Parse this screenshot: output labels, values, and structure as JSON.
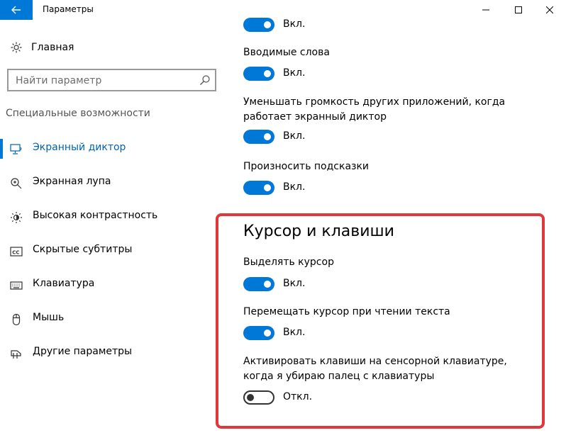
{
  "window": {
    "title": "Параметры"
  },
  "sidebar": {
    "home_label": "Главная",
    "search_placeholder": "Найти параметр",
    "section_label": "Специальные возможности",
    "items": [
      {
        "label": "Экранный диктор",
        "icon": "narrator-icon",
        "selected": true
      },
      {
        "label": "Экранная лупа",
        "icon": "magnifier-icon",
        "selected": false
      },
      {
        "label": "Высокая контрастность",
        "icon": "contrast-icon",
        "selected": false
      },
      {
        "label": "Скрытые субтитры",
        "icon": "captions-icon",
        "selected": false
      },
      {
        "label": "Клавиатура",
        "icon": "keyboard-icon",
        "selected": false
      },
      {
        "label": "Мышь",
        "icon": "mouse-icon",
        "selected": false
      },
      {
        "label": "Другие параметры",
        "icon": "other-options-icon",
        "selected": false
      }
    ]
  },
  "content": {
    "settings_top": [
      {
        "label": "",
        "state": "Вкл.",
        "on": true
      },
      {
        "label": "Вводимые слова",
        "state": "Вкл.",
        "on": true
      },
      {
        "label": "Уменьшать громкость других приложений, когда работает экранный диктор",
        "state": "Вкл.",
        "on": true
      },
      {
        "label": "Произносить подсказки",
        "state": "Вкл.",
        "on": true
      }
    ],
    "cursor_section": {
      "heading": "Курсор и клавиши",
      "settings": [
        {
          "label": "Выделять курсор",
          "state": "Вкл.",
          "on": true
        },
        {
          "label": "Перемещать курсор при чтении текста",
          "state": "Вкл.",
          "on": true
        },
        {
          "label": "Активировать клавиши на сенсорной клавиатуре, когда я убираю палец с клавиатуры",
          "state": "Откл.",
          "on": false
        }
      ]
    }
  },
  "colors": {
    "accent": "#0078d7",
    "highlight": "#e0383a"
  }
}
